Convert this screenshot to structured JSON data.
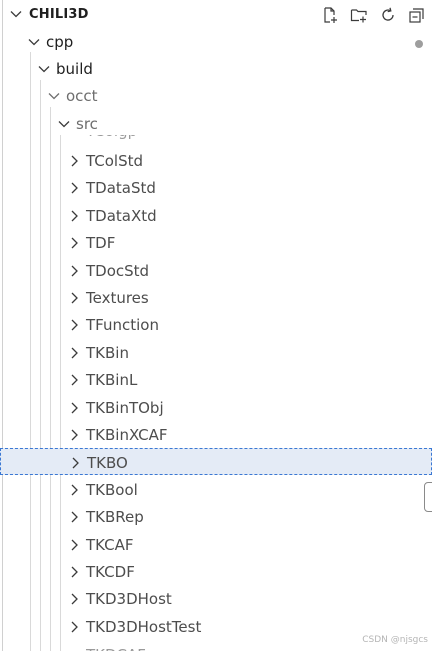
{
  "explorer": {
    "title": "CHILI3D",
    "actions": [
      {
        "name": "new-file",
        "icon": "new-file-icon"
      },
      {
        "name": "new-folder",
        "icon": "new-folder-icon"
      },
      {
        "name": "refresh",
        "icon": "refresh-icon"
      },
      {
        "name": "collapse-all",
        "icon": "collapse-all-icon"
      }
    ]
  },
  "tree": {
    "cpp": "cpp",
    "build": "build",
    "occt": "occt",
    "src": "src",
    "items": [
      "TColStd",
      "TDataStd",
      "TDataXtd",
      "TDF",
      "TDocStd",
      "Textures",
      "TFunction",
      "TKBin",
      "TKBinL",
      "TKBinTObj",
      "TKBinXCAF",
      "TKBO",
      "TKBool",
      "TKBRep",
      "TKCAF",
      "TKCDF",
      "TKD3DHost",
      "TKD3DHostTest"
    ],
    "selected": "TKBO"
  },
  "watermark": "CSDN @njsgcs",
  "colors": {
    "selection_bg": "#e4ebf6",
    "selection_border": "#3a78d4",
    "text": "#4d4d4d"
  }
}
